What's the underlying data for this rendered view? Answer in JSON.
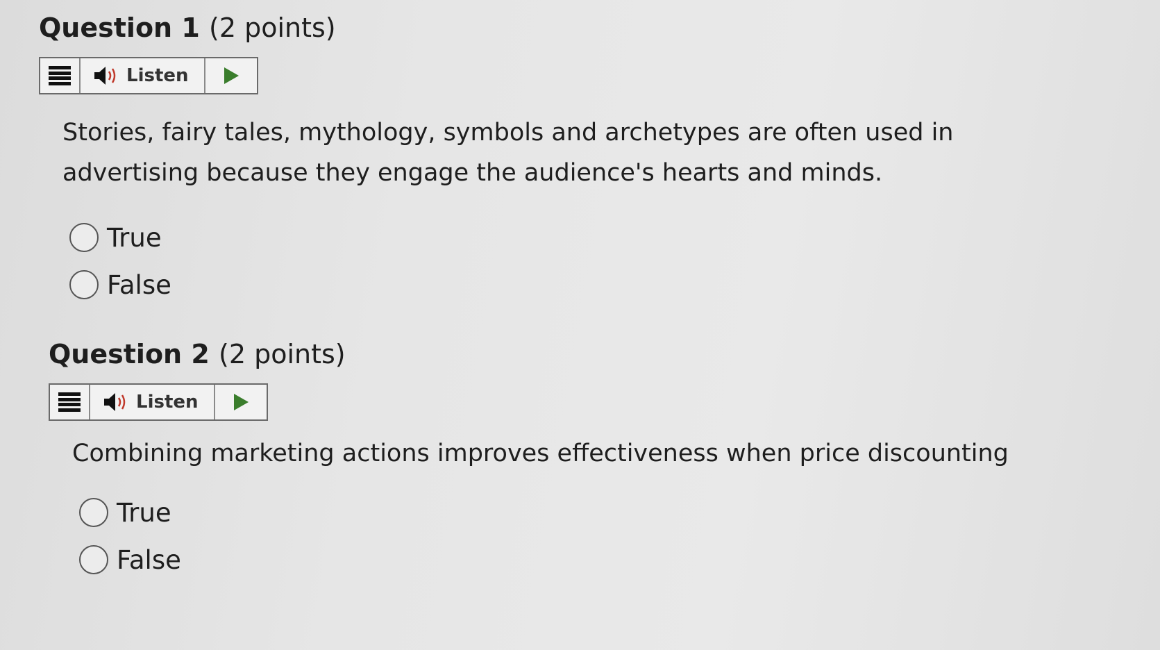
{
  "questions": [
    {
      "title": "Question 1",
      "points": "(2 points)",
      "toolbar": {
        "menu_icon": "hamburger-menu-icon",
        "listen_label": "Listen",
        "speaker_icon": "speaker-icon",
        "play_icon": "play-icon"
      },
      "text": "Stories, fairy tales, mythology, symbols and archetypes are often used in advertising because they engage the audience's hearts and minds.",
      "options": [
        {
          "label": "True"
        },
        {
          "label": "False"
        }
      ]
    },
    {
      "title": "Question 2",
      "points": "(2 points)",
      "toolbar": {
        "menu_icon": "hamburger-menu-icon",
        "listen_label": "Listen",
        "speaker_icon": "speaker-icon",
        "play_icon": "play-icon"
      },
      "text": "Combining marketing actions improves effectiveness when price discounting",
      "options": [
        {
          "label": "True"
        },
        {
          "label": "False"
        }
      ]
    }
  ],
  "colors": {
    "play_arrow": "#3a7d2c",
    "text": "#1e1e1e"
  }
}
